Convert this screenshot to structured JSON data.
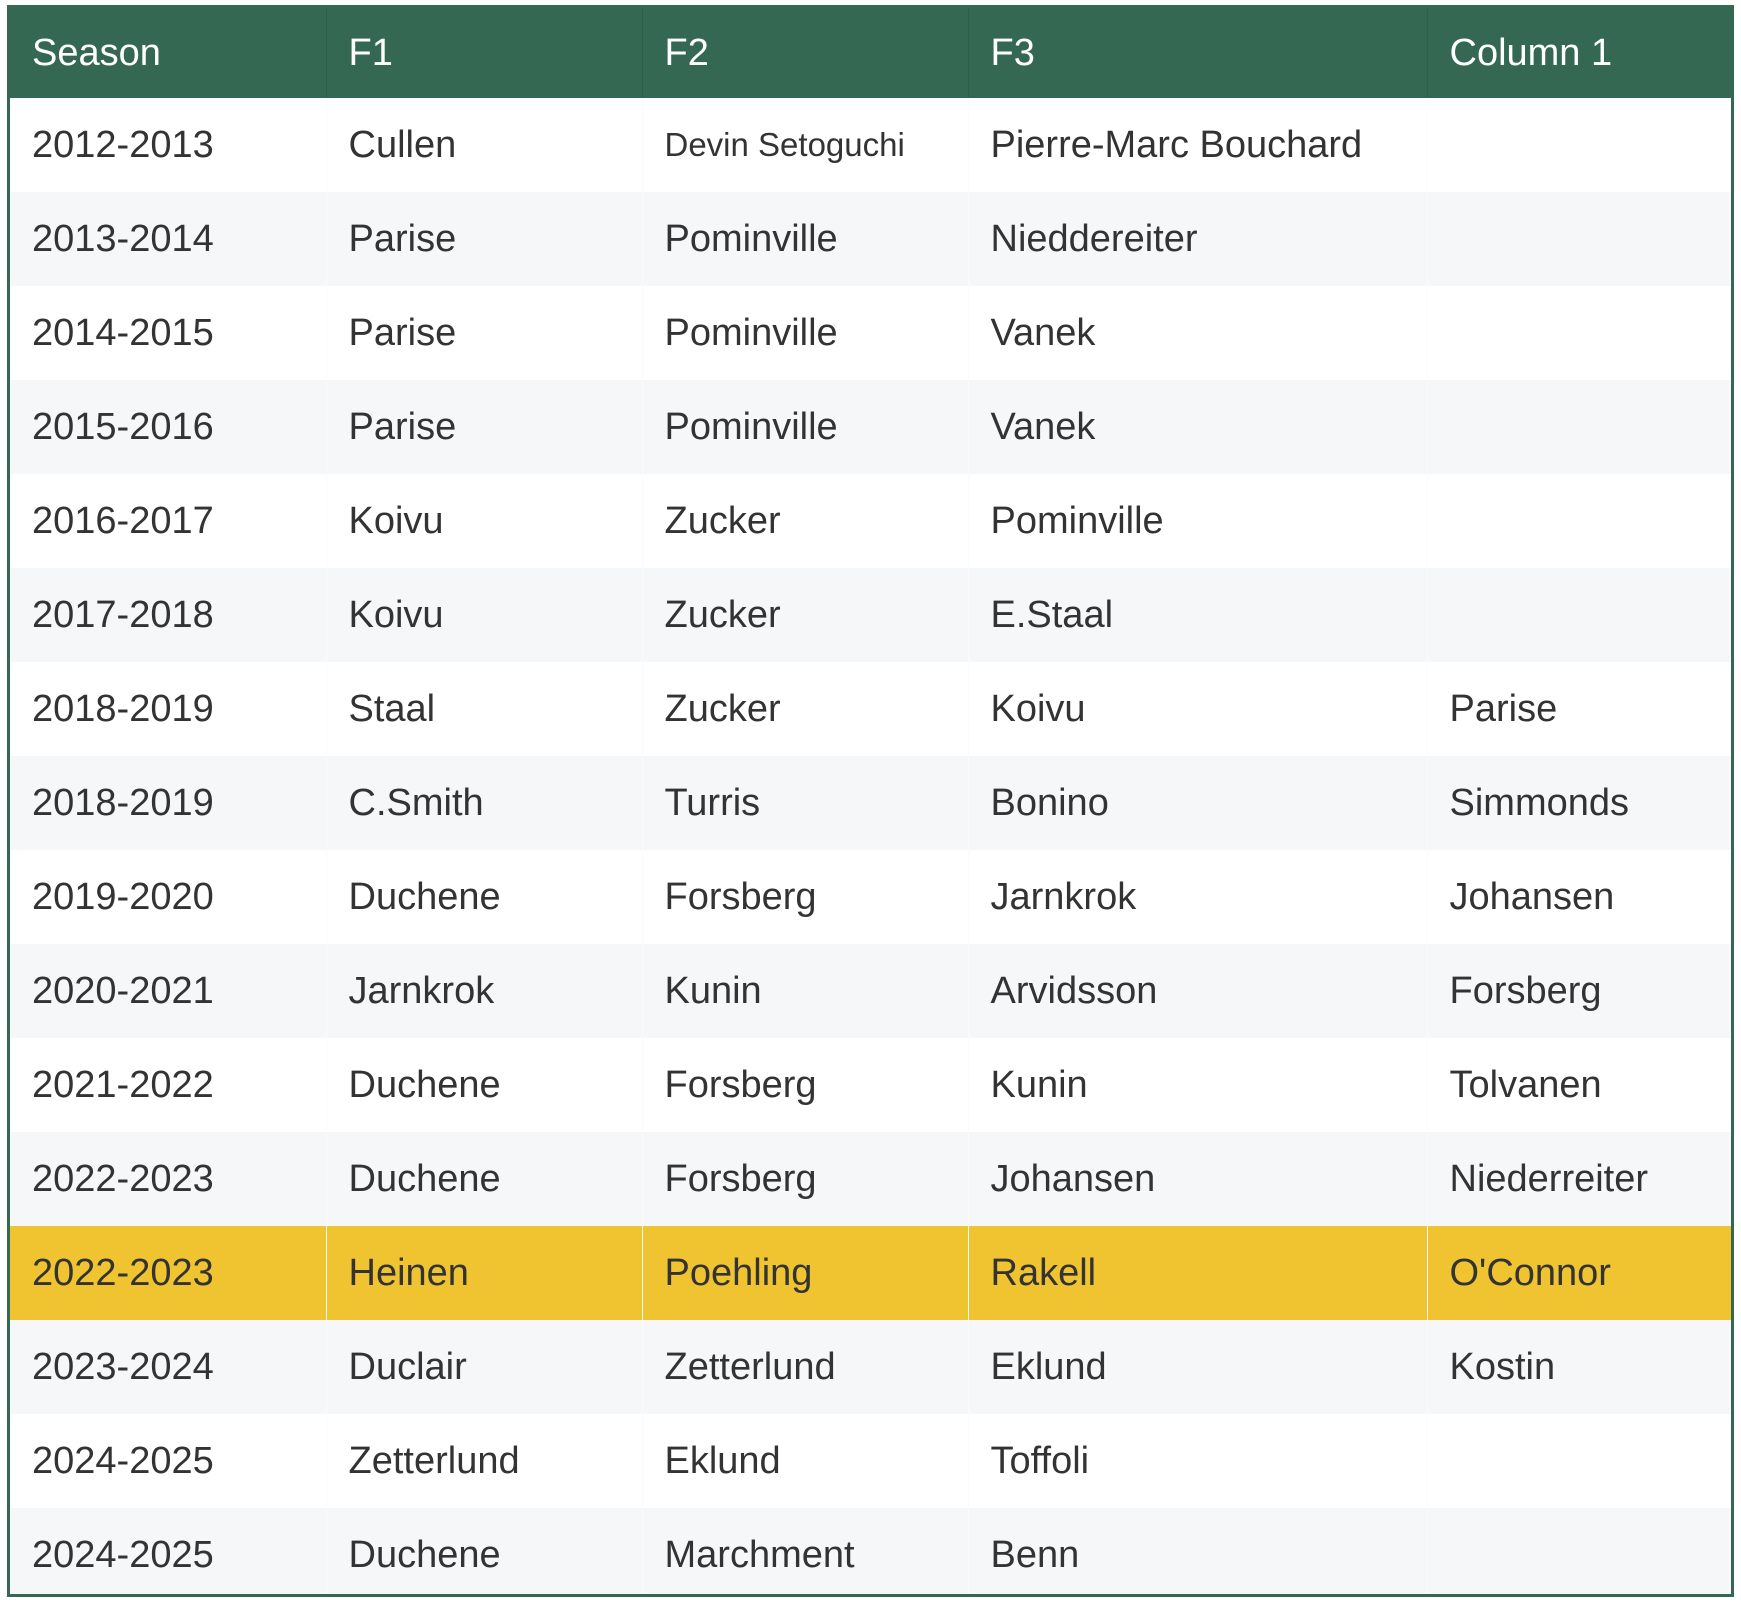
{
  "table": {
    "headers": [
      "Season",
      "F1",
      "F2",
      "F3",
      "Column 1"
    ],
    "rows": [
      [
        "2012-2013",
        "Cullen",
        "Devin Setoguchi",
        "Pierre-Marc Bouchard",
        ""
      ],
      [
        "2013-2014",
        "Parise",
        "Pominville",
        "Nieddereiter",
        ""
      ],
      [
        "2014-2015",
        "Parise",
        "Pominville",
        "Vanek",
        ""
      ],
      [
        "2015-2016",
        "Parise",
        "Pominville",
        "Vanek",
        ""
      ],
      [
        "2016-2017",
        "Koivu",
        "Zucker",
        "Pominville",
        ""
      ],
      [
        "2017-2018",
        "Koivu",
        "Zucker",
        "E.Staal",
        ""
      ],
      [
        "2018-2019",
        "Staal",
        "Zucker",
        "Koivu",
        "Parise"
      ],
      [
        "2018-2019",
        "C.Smith",
        "Turris",
        "Bonino",
        "Simmonds"
      ],
      [
        "2019-2020",
        "Duchene",
        "Forsberg",
        "Jarnkrok",
        "Johansen"
      ],
      [
        "2020-2021",
        "Jarnkrok",
        "Kunin",
        "Arvidsson",
        "Forsberg"
      ],
      [
        "2021-2022",
        "Duchene",
        "Forsberg",
        "Kunin",
        "Tolvanen"
      ],
      [
        "2022-2023",
        "Duchene",
        "Forsberg",
        "Johansen",
        "Niederreiter"
      ],
      [
        "2022-2023",
        "Heinen",
        "Poehling",
        "Rakell",
        "O'Connor"
      ],
      [
        "2023-2024",
        "Duclair",
        "Zetterlund",
        "Eklund",
        "Kostin"
      ],
      [
        "2024-2025",
        "Zetterlund",
        "Eklund",
        "Toffoli",
        ""
      ],
      [
        "2024-2025",
        "Duchene",
        "Marchment",
        "Benn",
        ""
      ]
    ],
    "highlighted_row_index": 12
  },
  "colors": {
    "header_background": "#356853",
    "header_text": "#ffffff",
    "row_odd": "#ffffff",
    "row_even": "#f6f7f9",
    "highlight": "#f0c430",
    "body_text": "#333333"
  }
}
